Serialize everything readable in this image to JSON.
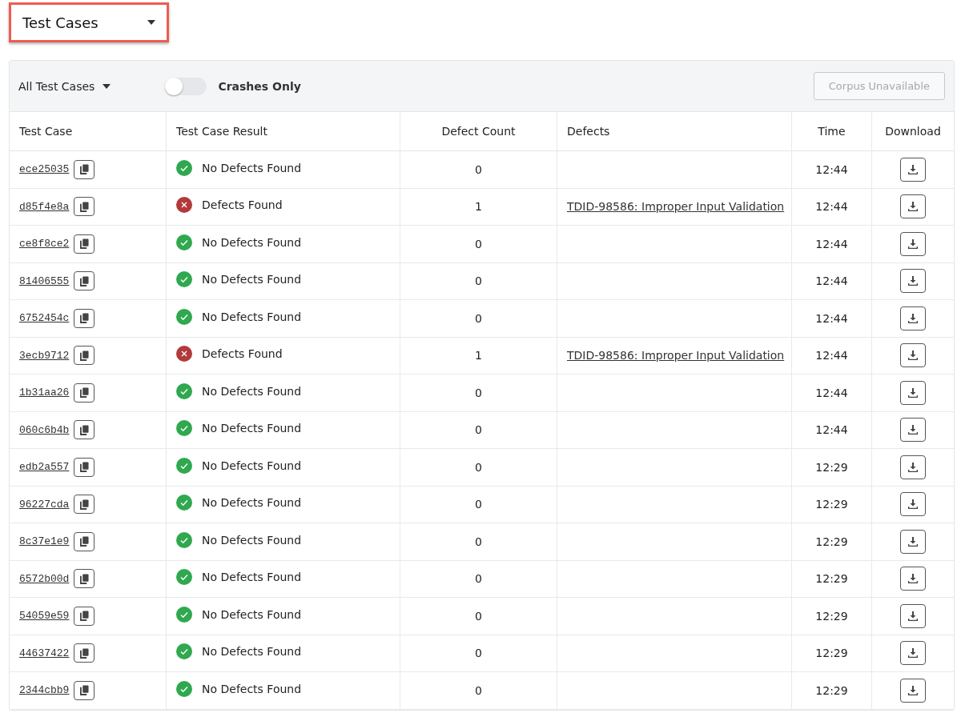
{
  "view_selector": {
    "label": "Test Cases",
    "highlighted": true
  },
  "toolbar": {
    "filter": "All Test Cases",
    "toggle": {
      "label": "Crashes Only",
      "on": false
    },
    "corpus_button": {
      "label": "Corpus Unavailable",
      "disabled": true
    }
  },
  "table": {
    "columns": [
      "Test Case",
      "Test Case Result",
      "Defect Count",
      "Defects",
      "Time",
      "Download"
    ],
    "rows": [
      {
        "id": "ece25035",
        "result": {
          "kind": "pass",
          "text": "No Defects Found"
        },
        "count": "0",
        "defect": "",
        "time": "12:44"
      },
      {
        "id": "d85f4e8a",
        "result": {
          "kind": "fail",
          "text": "Defects Found"
        },
        "count": "1",
        "defect": "TDID-98586: Improper Input Validation",
        "time": "12:44"
      },
      {
        "id": "ce8f8ce2",
        "result": {
          "kind": "pass",
          "text": "No Defects Found"
        },
        "count": "0",
        "defect": "",
        "time": "12:44"
      },
      {
        "id": "81406555",
        "result": {
          "kind": "pass",
          "text": "No Defects Found"
        },
        "count": "0",
        "defect": "",
        "time": "12:44"
      },
      {
        "id": "6752454c",
        "result": {
          "kind": "pass",
          "text": "No Defects Found"
        },
        "count": "0",
        "defect": "",
        "time": "12:44"
      },
      {
        "id": "3ecb9712",
        "result": {
          "kind": "fail",
          "text": "Defects Found"
        },
        "count": "1",
        "defect": "TDID-98586: Improper Input Validation",
        "time": "12:44"
      },
      {
        "id": "1b31aa26",
        "result": {
          "kind": "pass",
          "text": "No Defects Found"
        },
        "count": "0",
        "defect": "",
        "time": "12:44"
      },
      {
        "id": "060c6b4b",
        "result": {
          "kind": "pass",
          "text": "No Defects Found"
        },
        "count": "0",
        "defect": "",
        "time": "12:44"
      },
      {
        "id": "edb2a557",
        "result": {
          "kind": "pass",
          "text": "No Defects Found"
        },
        "count": "0",
        "defect": "",
        "time": "12:29"
      },
      {
        "id": "96227cda",
        "result": {
          "kind": "pass",
          "text": "No Defects Found"
        },
        "count": "0",
        "defect": "",
        "time": "12:29"
      },
      {
        "id": "8c37e1e9",
        "result": {
          "kind": "pass",
          "text": "No Defects Found"
        },
        "count": "0",
        "defect": "",
        "time": "12:29"
      },
      {
        "id": "6572b00d",
        "result": {
          "kind": "pass",
          "text": "No Defects Found"
        },
        "count": "0",
        "defect": "",
        "time": "12:29"
      },
      {
        "id": "54059e59",
        "result": {
          "kind": "pass",
          "text": "No Defects Found"
        },
        "count": "0",
        "defect": "",
        "time": "12:29"
      },
      {
        "id": "44637422",
        "result": {
          "kind": "pass",
          "text": "No Defects Found"
        },
        "count": "0",
        "defect": "",
        "time": "12:29"
      },
      {
        "id": "2344cbb9",
        "result": {
          "kind": "pass",
          "text": "No Defects Found"
        },
        "count": "0",
        "defect": "",
        "time": "12:29"
      }
    ]
  }
}
